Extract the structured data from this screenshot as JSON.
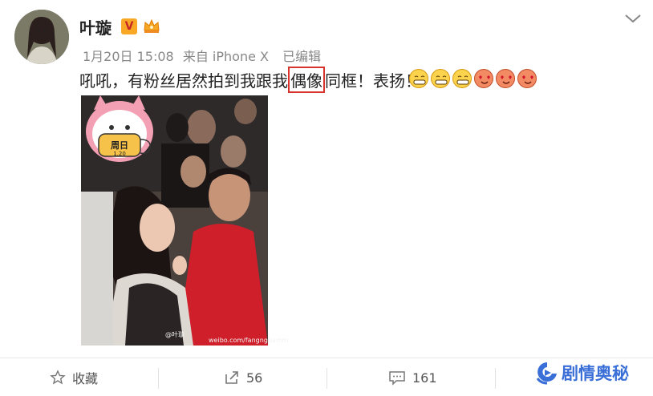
{
  "post": {
    "username": "叶璇",
    "verified_badge": "V",
    "date": "1月20日 15:08",
    "source": "来自 iPhone X",
    "edited": "已编辑",
    "text_before": "吼吼，有粉丝居然拍到我跟我",
    "text_highlight": "偶像",
    "text_after": "同框！表扬！",
    "emojis": [
      "grin-emoji",
      "grin-emoji",
      "grin-emoji",
      "heart-eyes-emoji",
      "heart-eyes-emoji",
      "heart-eyes-emoji"
    ],
    "photo_sticker_text": "周日",
    "photo_sticker_date": "1.20",
    "photo_watermark": "@叶璇",
    "photo_watermark_url": "weibo.com/fangnguamm"
  },
  "actions": {
    "favorite_label": "收藏",
    "repost_count": "56",
    "comment_count": "161"
  },
  "brand": {
    "name": "剧情奥秘"
  },
  "colors": {
    "highlight_border": "#d9342b",
    "brand_blue": "#3b6fd8",
    "badge_gold": "#f9a825"
  }
}
